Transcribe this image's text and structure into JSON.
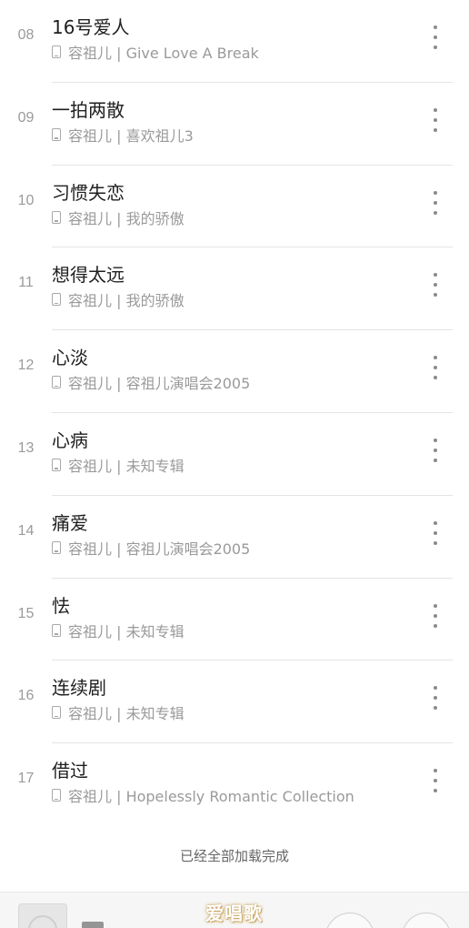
{
  "songs": [
    {
      "index": "08",
      "title": "16号爱人",
      "meta": "容祖儿 | Give Love A Break"
    },
    {
      "index": "09",
      "title": "一拍两散",
      "meta": "容祖儿 | 喜欢祖儿3"
    },
    {
      "index": "10",
      "title": "习惯失恋",
      "meta": "容祖儿 | 我的骄傲"
    },
    {
      "index": "11",
      "title": "想得太远",
      "meta": "容祖儿 | 我的骄傲"
    },
    {
      "index": "12",
      "title": "心淡",
      "meta": "容祖儿 | 容祖儿演唱会2005"
    },
    {
      "index": "13",
      "title": "心病",
      "meta": "容祖儿 | 未知专辑"
    },
    {
      "index": "14",
      "title": "痛爱",
      "meta": "容祖儿 | 容祖儿演唱会2005"
    },
    {
      "index": "15",
      "title": "怯",
      "meta": "容祖儿 | 未知专辑"
    },
    {
      "index": "16",
      "title": "连续剧",
      "meta": "容祖儿 | 未知专辑"
    },
    {
      "index": "17",
      "title": "借过",
      "meta": "容祖儿 | Hopelessly Romantic Collection"
    }
  ],
  "footer": {
    "loaded_text": "已经全部加载完成"
  },
  "watermark": {
    "text": "爱唱歌"
  },
  "icons": {
    "local_file": "phone-icon",
    "more": "more-vertical-icon",
    "play": "play-icon",
    "playlist": "playlist-icon"
  },
  "colors": {
    "background": "#ffffff",
    "divider": "#e4e4e4",
    "secondary_text": "#9a9a9a",
    "primary_text": "#1f1f1f"
  }
}
